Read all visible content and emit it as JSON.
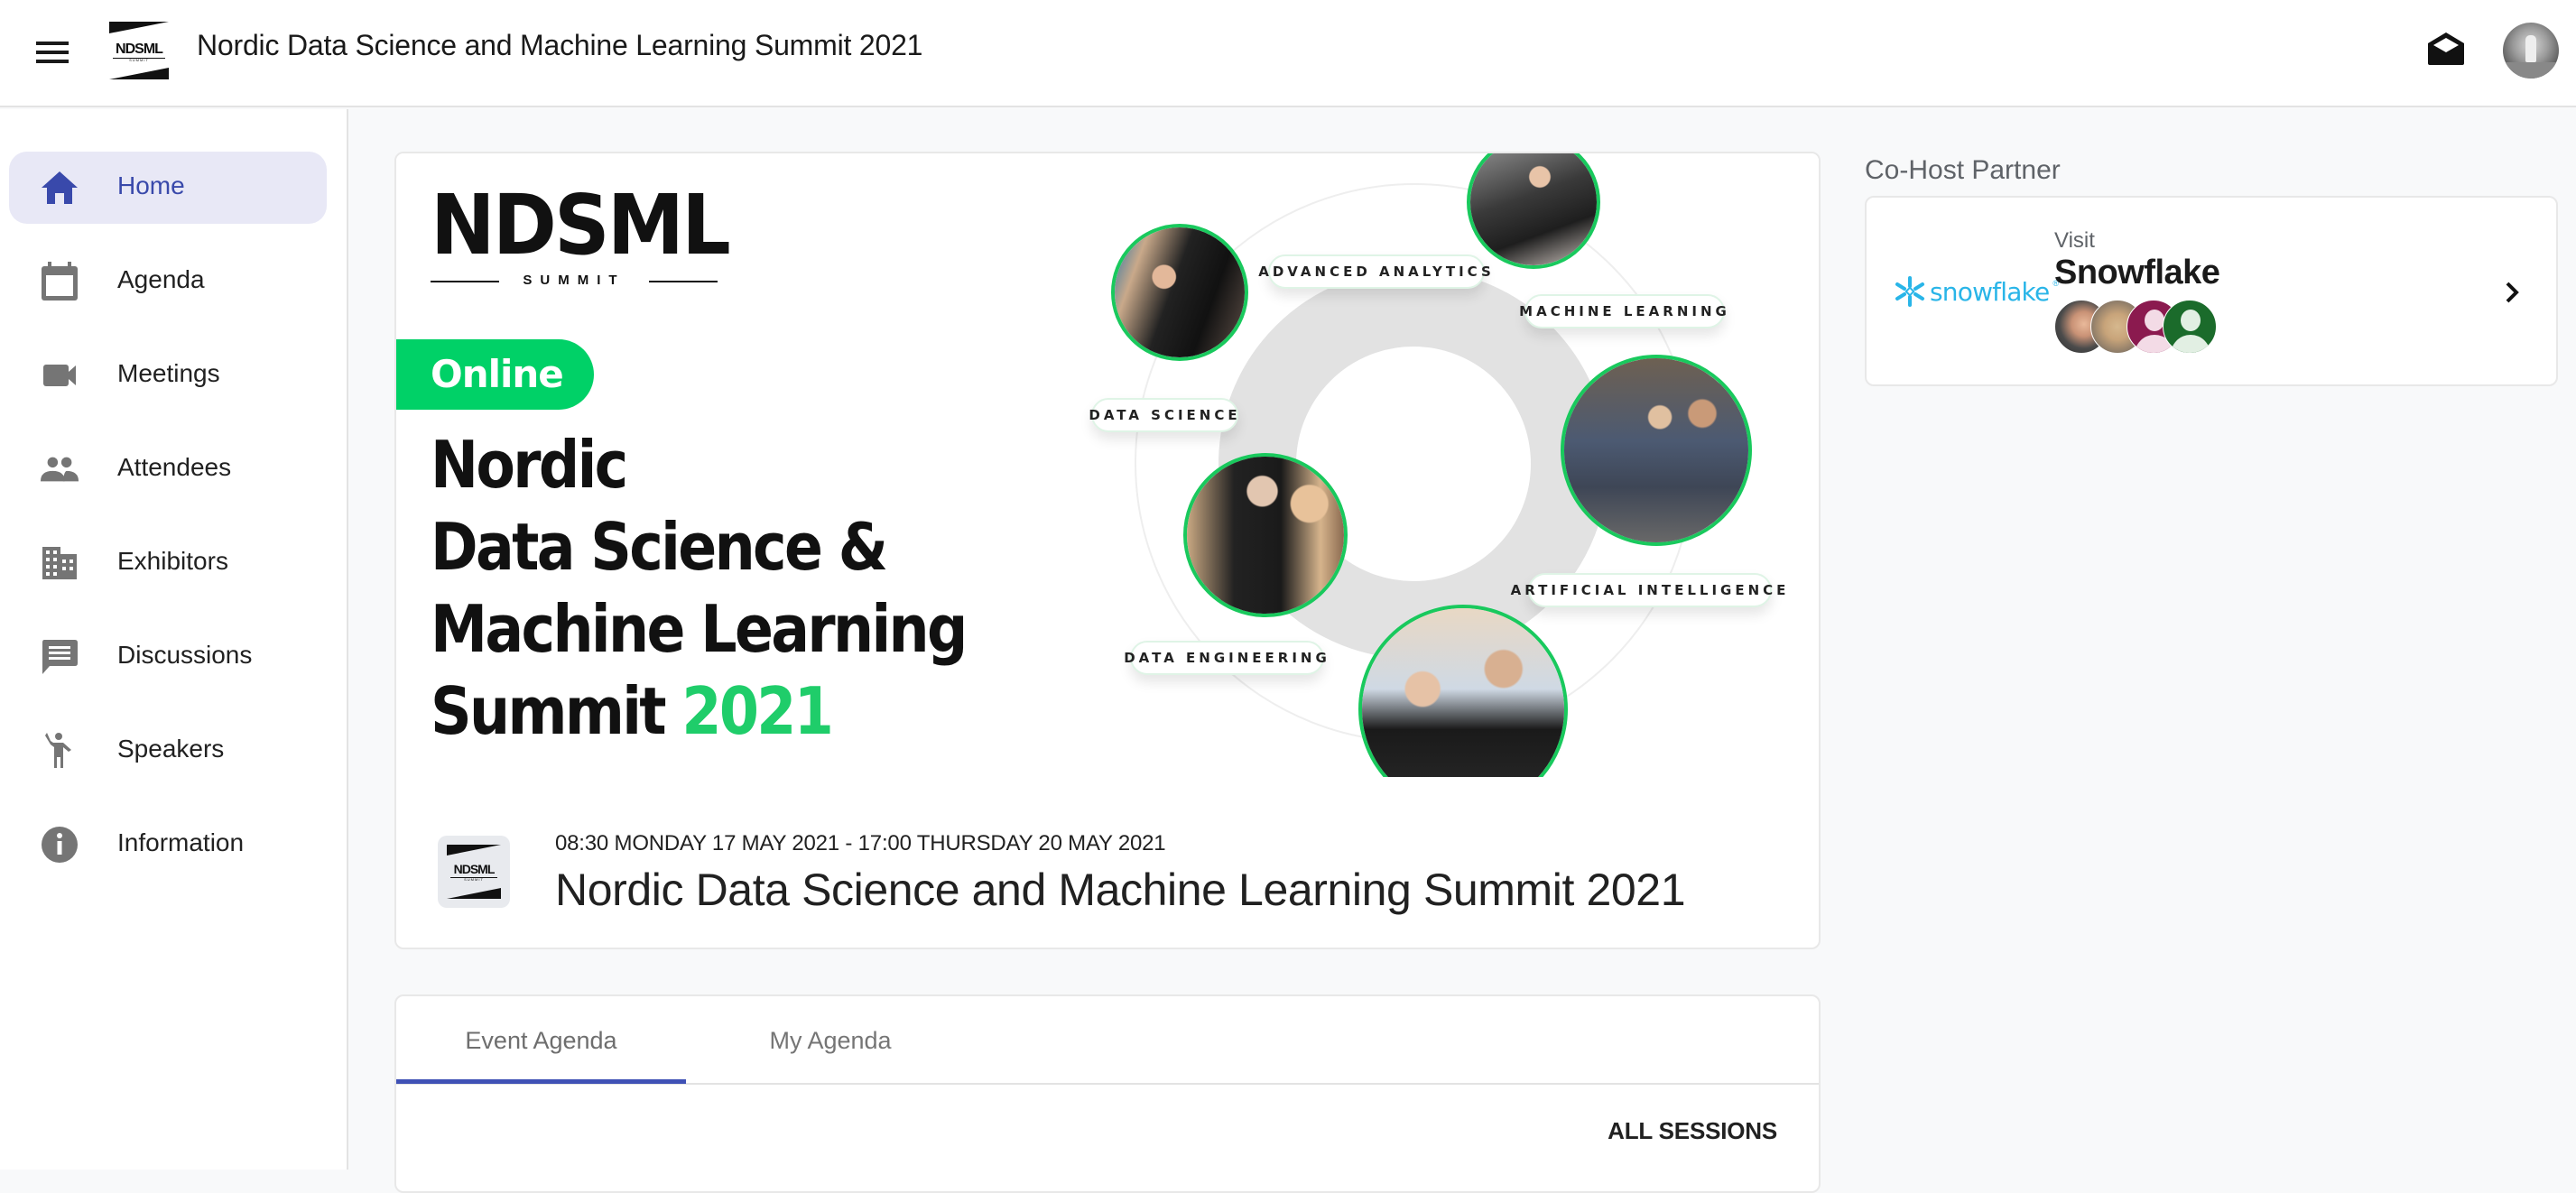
{
  "header": {
    "title": "Nordic Data Science and Machine Learning Summit 2021",
    "logo_text": "NDSML",
    "logo_subtext": "SUMMIT",
    "icons": {
      "menu": "menu-icon",
      "mail": "mail-open-icon",
      "avatar": "user-avatar"
    }
  },
  "sidebar": {
    "items": [
      {
        "label": "Home",
        "icon": "home-icon",
        "active": true
      },
      {
        "label": "Agenda",
        "icon": "calendar-icon",
        "active": false
      },
      {
        "label": "Meetings",
        "icon": "videocam-icon",
        "active": false
      },
      {
        "label": "Attendees",
        "icon": "people-icon",
        "active": false
      },
      {
        "label": "Exhibitors",
        "icon": "building-icon",
        "active": false
      },
      {
        "label": "Discussions",
        "icon": "chat-icon",
        "active": false
      },
      {
        "label": "Speakers",
        "icon": "speaker-person-icon",
        "active": false
      },
      {
        "label": "Information",
        "icon": "info-icon",
        "active": false
      }
    ]
  },
  "banner": {
    "logo_text": "NDSML",
    "logo_subtext": "SUMMIT",
    "badge": "Online",
    "headline_lines": [
      "Nordic",
      "Data Science &",
      "Machine Learning",
      "Summit"
    ],
    "headline_year": "2021",
    "topics": [
      "ADVANCED ANALYTICS",
      "MACHINE LEARNING",
      "DATA SCIENCE",
      "ARTIFICIAL INTELLIGENCE",
      "DATA ENGINEERING"
    ],
    "colors": {
      "accent_green": "#00d167",
      "photo_border": "#19c95d"
    }
  },
  "event": {
    "dates": "08:30 MONDAY 17 MAY 2021 - 17:00 THURSDAY 20 MAY 2021",
    "name": "Nordic Data Science and Machine Learning Summit 2021",
    "logo_text": "NDSML",
    "logo_subtext": "SUMMIT"
  },
  "agenda": {
    "tabs": [
      {
        "label": "Event Agenda",
        "active": true
      },
      {
        "label": "My Agenda",
        "active": false
      }
    ],
    "filter_label": "ALL SESSIONS",
    "colors": {
      "tab_indicator": "#3f51b5"
    }
  },
  "cohost": {
    "section_title": "Co-Host Partner",
    "visit_label": "Visit",
    "partner_name": "Snowflake",
    "partner_logo_text": "snowflake",
    "brand_color": "#29b5e8",
    "avatars": [
      "photo",
      "photo",
      "default-avatar",
      "default-avatar"
    ],
    "avatar_colors": [
      "#8b1a4f",
      "#1b6b2b"
    ]
  }
}
